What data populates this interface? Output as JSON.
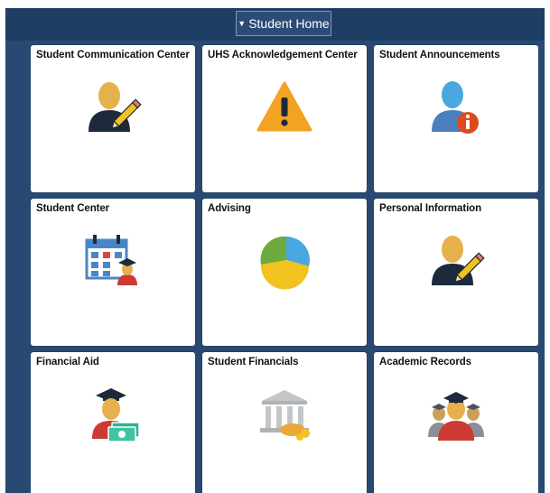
{
  "header": {
    "homepage_label": "Student Home",
    "caret": "▼"
  },
  "tiles": [
    {
      "title": "Student Communication Center",
      "icon": "person-pencil-icon"
    },
    {
      "title": "UHS Acknowledgement Center",
      "icon": "warning-triangle-icon"
    },
    {
      "title": "Student Announcements",
      "icon": "person-info-icon"
    },
    {
      "title": "Student Center",
      "icon": "calendar-student-icon"
    },
    {
      "title": "Advising",
      "icon": "pie-chart-icon"
    },
    {
      "title": "Personal Information",
      "icon": "person-pencil-icon"
    },
    {
      "title": "Financial Aid",
      "icon": "graduate-money-icon"
    },
    {
      "title": "Student Financials",
      "icon": "bank-coins-icon"
    },
    {
      "title": "Academic Records",
      "icon": "graduates-group-icon"
    }
  ],
  "colors": {
    "frame_bg": "#284a72",
    "header_bg": "#1f3e63",
    "tile_bg": "#ffffff",
    "person_skin": "#e6b04c",
    "person_body": "#1d2a3c",
    "warning": "#f3a222",
    "info_badge": "#dd4a1c",
    "pie_blue": "#4aa8e0",
    "pie_yellow": "#f2c21f",
    "pie_green": "#6cab3c",
    "gown_red": "#cc3a33"
  }
}
